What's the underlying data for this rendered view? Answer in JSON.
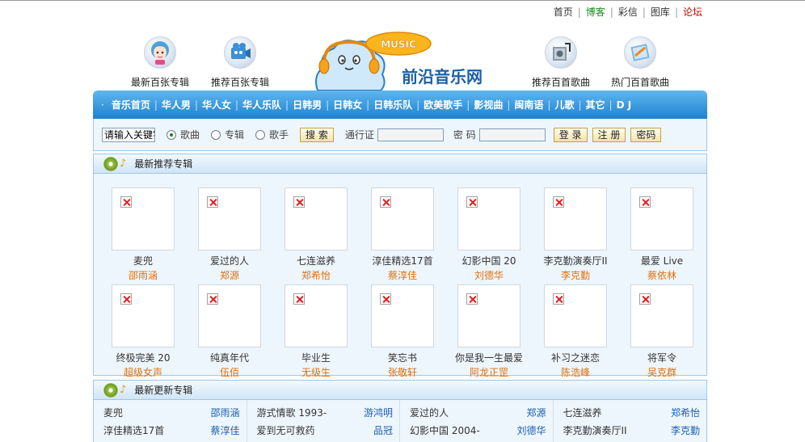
{
  "top_links": [
    {
      "label": "首页",
      "color": "#333333"
    },
    {
      "label": "博客",
      "color": "#1a8a1a"
    },
    {
      "label": "彩信",
      "color": "#333333"
    },
    {
      "label": "图库",
      "color": "#333333"
    },
    {
      "label": "论坛",
      "color": "#cc0000"
    }
  ],
  "header": {
    "items_left": [
      {
        "label": "最新百张专辑",
        "icon": "girl-avatar-icon"
      },
      {
        "label": "推荐百张专辑",
        "icon": "camera-icon"
      }
    ],
    "items_right": [
      {
        "label": "推荐百首歌曲",
        "icon": "music-box-icon"
      },
      {
        "label": "热门百首歌曲",
        "icon": "cd-case-icon"
      }
    ],
    "logo_badge": "MUSIC",
    "logo_text": "前沿音乐网"
  },
  "nav": {
    "items": [
      "音乐首页",
      "华人男",
      "华人女",
      "华人乐队",
      "日韩男",
      "日韩女",
      "日韩乐队",
      "欧美歌手",
      "影视曲",
      "闽南语",
      "儿歌",
      "其它",
      "D J"
    ],
    "accent": "#2a8ad8"
  },
  "search": {
    "keyword_value": "请输入关键字",
    "radio_options": [
      {
        "label": "歌曲",
        "selected": true
      },
      {
        "label": "专辑",
        "selected": false
      },
      {
        "label": "歌手",
        "selected": false
      }
    ],
    "search_button": "搜 索",
    "pass_label": "通行证",
    "password_label": "密 码",
    "login_button": "登 录",
    "register_button": "注 册",
    "pwd_button": "密码"
  },
  "sections": {
    "recommended_title": "最新推荐专辑",
    "updated_title": "最新更新专辑"
  },
  "albums": [
    {
      "name": "麦兜",
      "artist": "邵雨涵"
    },
    {
      "name": "爱过的人",
      "artist": "郑源"
    },
    {
      "name": "七连滋养",
      "artist": "郑希怡"
    },
    {
      "name": "淳佳精选17首",
      "artist": "蔡淳佳"
    },
    {
      "name": "幻影中国 20",
      "artist": "刘德华"
    },
    {
      "name": "李克勤演奏厅II",
      "artist": "李克勤"
    },
    {
      "name": "最爱 Live",
      "artist": "蔡依林"
    },
    {
      "name": "终极完美 20",
      "artist": "超级女声"
    },
    {
      "name": "纯真年代",
      "artist": "伍佰"
    },
    {
      "name": "毕业生",
      "artist": "无级生"
    },
    {
      "name": "笑忘书",
      "artist": "张敬轩"
    },
    {
      "name": "你是我一生最爱",
      "artist": "阿龙正罡"
    },
    {
      "name": "补习之迷恋",
      "artist": "陈浩峰"
    },
    {
      "name": "将军令",
      "artist": "吴克群"
    }
  ],
  "updated_columns": [
    [
      {
        "title": "麦兜",
        "artist": "邵雨涵"
      },
      {
        "title": "淳佳精选17首",
        "artist": "蔡淳佳"
      }
    ],
    [
      {
        "title": "游式情歌 1993-",
        "artist": "游鸿明"
      },
      {
        "title": "爱到无可救药",
        "artist": "品冠"
      }
    ],
    [
      {
        "title": "爱过的人",
        "artist": "郑源"
      },
      {
        "title": "幻影中国 2004-",
        "artist": "刘德华"
      }
    ],
    [
      {
        "title": "七连滋养",
        "artist": "郑希怡"
      },
      {
        "title": "李克勤演奏厅II",
        "artist": "李克勤"
      }
    ]
  ]
}
